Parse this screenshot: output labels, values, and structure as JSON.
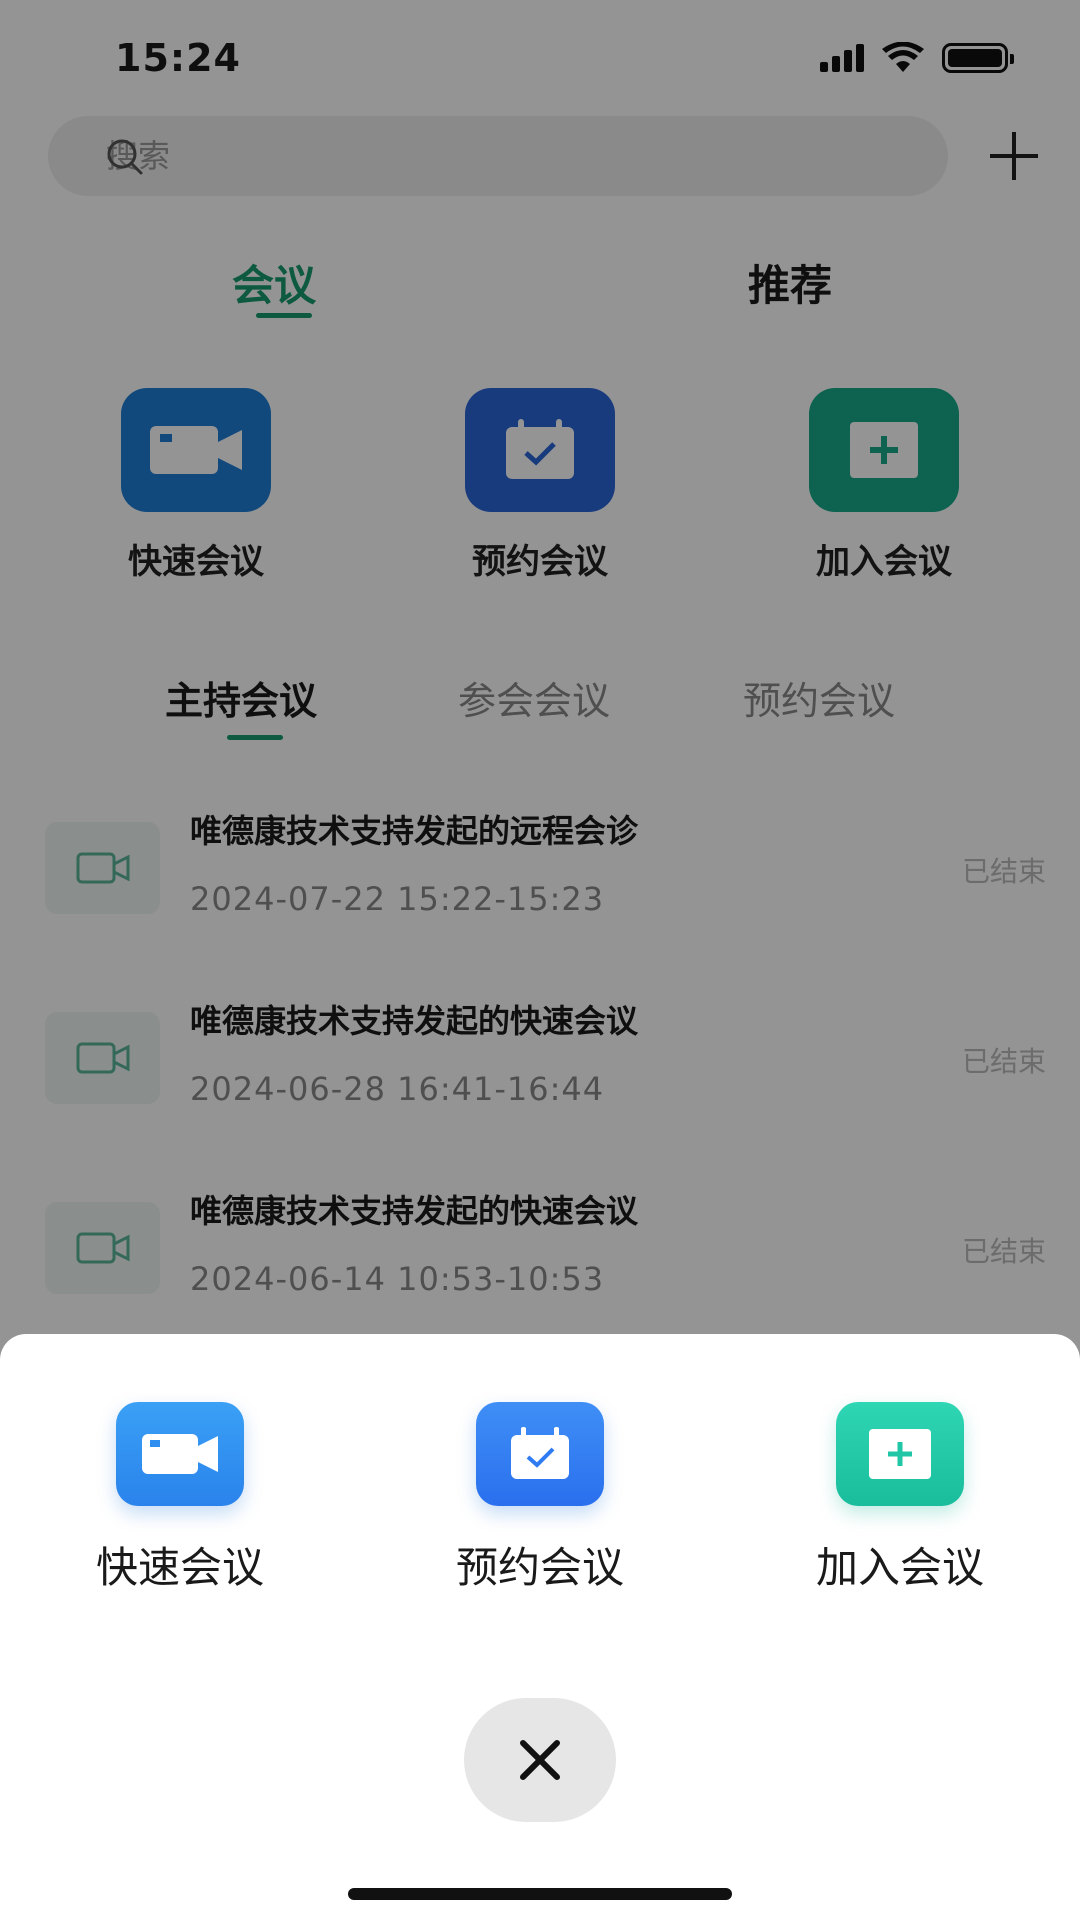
{
  "status_bar": {
    "time": "15:24"
  },
  "search": {
    "placeholder": "搜索"
  },
  "top_tabs": {
    "active": "会议",
    "inactive": "推荐"
  },
  "quick_actions": [
    {
      "label": "快速会议",
      "icon": "video-camera-icon",
      "color": "#1f7fd8"
    },
    {
      "label": "预约会议",
      "icon": "calendar-check-icon",
      "color": "#2a67d9"
    },
    {
      "label": "加入会议",
      "icon": "add-meeting-icon",
      "color": "#17a98a"
    }
  ],
  "sub_tabs": [
    "主持会议",
    "参会会议",
    "预约会议"
  ],
  "meetings": [
    {
      "title": "唯德康技术支持发起的远程会诊",
      "time": "2024-07-22  15:22-15:23",
      "status": "已结束"
    },
    {
      "title": "唯德康技术支持发起的快速会议",
      "time": "2024-06-28  16:41-16:44",
      "status": "已结束"
    },
    {
      "title": "唯德康技术支持发起的快速会议",
      "time": "2024-06-14  10:53-10:53",
      "status": "已结束"
    }
  ],
  "sheet": {
    "actions": [
      {
        "label": "快速会议",
        "icon": "video-camera-icon",
        "color": "#2f8ff0"
      },
      {
        "label": "预约会议",
        "icon": "calendar-check-icon",
        "color": "#2f7cf2"
      },
      {
        "label": "加入会议",
        "icon": "add-meeting-icon",
        "color": "#1fc7a6"
      }
    ],
    "close_icon": "close-icon"
  },
  "colors": {
    "accent": "#179b70"
  }
}
